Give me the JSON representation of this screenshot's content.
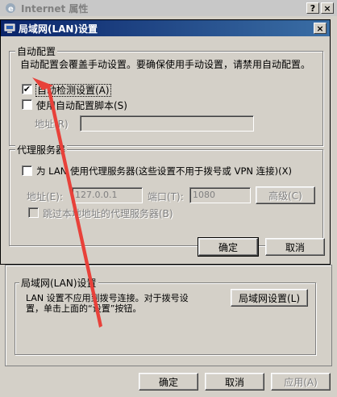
{
  "outer": {
    "title": "Internet 属性",
    "help_glyph": "?",
    "close_glyph": "×",
    "lan_group_label": "局域网(LAN)设置",
    "lan_desc_line1": "LAN 设置不应用到拨号连接。对于拨号设",
    "lan_desc_line2": "置，单击上面的“设置”按钮。",
    "lan_settings_button": "局域网设置(L)",
    "ok_button": "确定",
    "cancel_button": "取消",
    "apply_button": "应用(A)"
  },
  "lan_dialog": {
    "title": "局域网(LAN)设置",
    "close_glyph": "×",
    "auto_config": {
      "group_label": "自动配置",
      "description": "自动配置会覆盖手动设置。要确保使用手动设置，请禁用自动配置。",
      "auto_detect_label": "自动检测设置(A)",
      "auto_detect_checked": true,
      "use_script_label": "使用自动配置脚本(S)",
      "use_script_checked": false,
      "address_label": "地址(R)",
      "address_value": ""
    },
    "proxy": {
      "group_label": "代理服务器",
      "use_proxy_label": "为 LAN 使用代理服务器(这些设置不用于拨号或 VPN 连接)(X)",
      "use_proxy_checked": false,
      "address_label": "地址(E):",
      "address_value": "127.0.0.1",
      "port_label": "端口(T):",
      "port_value": "1080",
      "advanced_button": "高级(C)",
      "bypass_label": "跳过本地地址的代理服务器(B)",
      "bypass_checked": false
    },
    "ok_button": "确定",
    "cancel_button": "取消"
  },
  "colors": {
    "title_active": "#0a246a",
    "dialog_face": "#d4d0c8",
    "annotation_arrow": "#e8413a"
  }
}
